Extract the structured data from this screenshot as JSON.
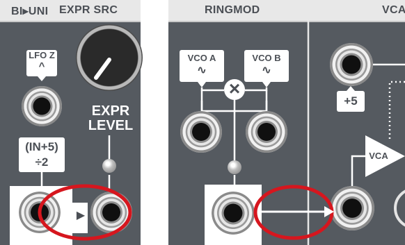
{
  "left_panel": {
    "header_left": "BI▸UNI",
    "header_right": "EXPR SRC",
    "lfo_label": "LFO Z",
    "lfo_symbol": "^",
    "formula_line1": "(IN+5)",
    "formula_line2": "÷2",
    "expr_line1": "EXPR",
    "expr_line2": "LEVEL",
    "normal_arrow": "▶"
  },
  "right_panel": {
    "header_ringmod": "RINGMOD",
    "header_vca": "VCA",
    "vco_a_label": "VCO A",
    "vco_b_label": "VCO B",
    "wave_symbol": "∿",
    "mult_symbol": "×",
    "plus5_label": "+5",
    "vca_triangle_label": "VCA"
  },
  "colors": {
    "panel": "#555a60",
    "header": "#e8e8e8",
    "highlight": "#d6161e",
    "ink": "#ffffff"
  }
}
